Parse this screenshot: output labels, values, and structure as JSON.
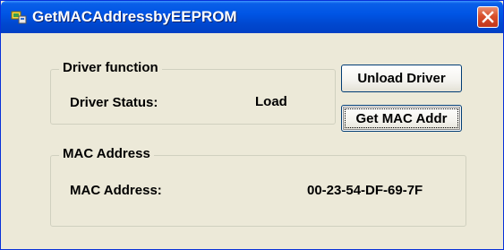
{
  "window": {
    "title": "GetMACAddressbyEEPROM",
    "app_icon": "app-window-icon",
    "close_icon": "close-icon",
    "title_color": "#0055e5",
    "close_color": "#d8502c"
  },
  "driver_group": {
    "label": "Driver function",
    "status_label": "Driver Status:",
    "status_value": "Load"
  },
  "buttons": {
    "unload_label": "Unload Driver",
    "get_mac_label": "Get MAC Addr"
  },
  "mac_group": {
    "label": "MAC Address",
    "mac_label": "MAC Address:",
    "mac_value": "00-23-54-DF-69-7F"
  }
}
